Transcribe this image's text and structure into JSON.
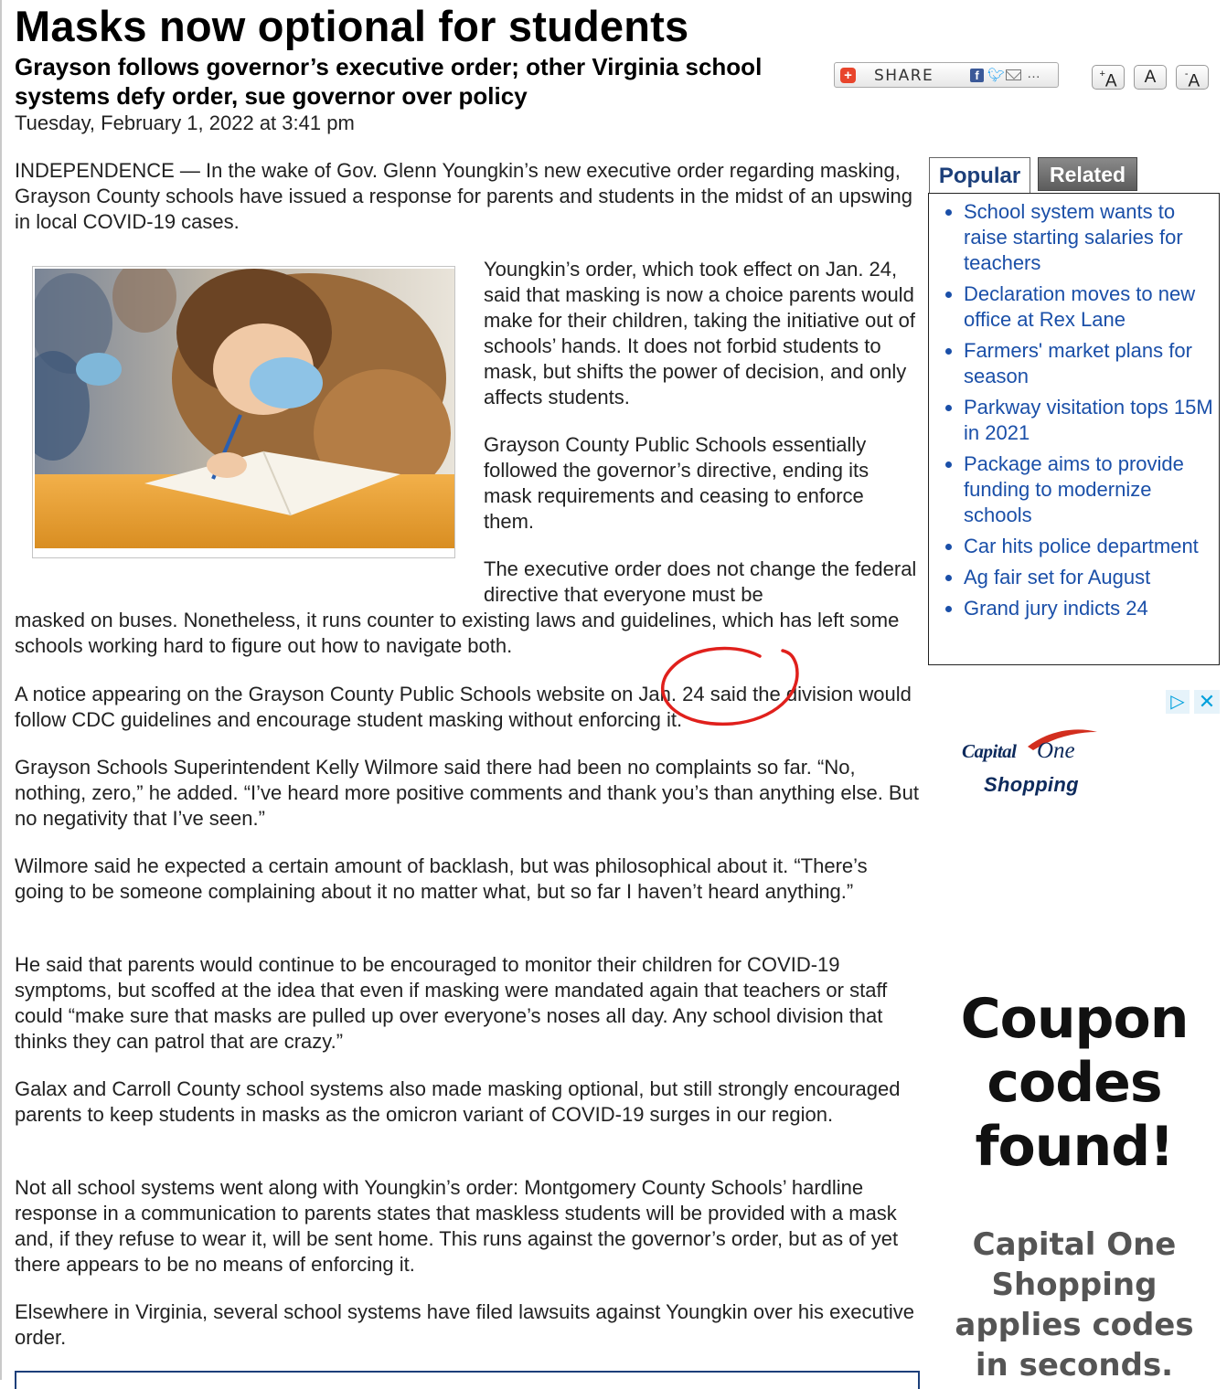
{
  "article": {
    "headline": "Masks now optional for students",
    "subhead": "Grayson follows governor’s executive order; other Virginia school systems defy order, sue governor over policy",
    "dateline": "Tuesday, February 1, 2022 at 3:41 pm",
    "paragraphs": [
      "INDEPENDENCE — In the wake of Gov. Glenn Youngkin’s new executive order regarding masking, Grayson County schools have issued a response for parents and students in the midst of an upswing in local COVID-19 cases.",
      "Youngkin’s order, which took effect on Jan. 24, said that masking is now a choice parents would make for their children, taking the initiative out of schools’ hands. It does not forbid students to mask, but shifts the power of decision, and only affects students.",
      "Grayson County Public Schools essentially followed the governor’s directive, ending its mask requirements and ceasing to enforce them.",
      "The executive order does not change the federal directive that everyone must be",
      "masked on buses. Nonetheless, it runs counter to existing laws and guidelines, which has left some schools working hard to figure out how to navigate both.",
      "A notice appearing on the Grayson County Public Schools website on Jan. 24 said the division would follow CDC guidelines and encourage student masking without enforcing it.",
      "Grayson Schools Superintendent Kelly Wilmore said there had been no complaints so far. “No, nothing, zero,” he added. “I’ve heard more positive comments and thank you’s than anything else. But no negativity that I’ve seen.”",
      "Wilmore said he expected a certain amount of backlash, but was philosophical about it. “There’s going to be someone complaining about it no matter what, but so far I haven’t heard anything.”",
      "He said that parents would continue to be encouraged to monitor their children for COVID-19 symptoms, but scoffed at the idea that even if masking were mandated again that teachers or staff could “make sure that masks are pulled up over everyone’s noses all day. Any school division that thinks they can patrol that are crazy.”",
      "Galax and Carroll County school systems also made masking optional, but still strongly encouraged parents to keep students in masks as the omicron variant of COVID-19 surges in our region.",
      "Not all school systems went along with Youngkin’s order: Montgomery County Schools’ hardline response in a communication to parents states that maskless students will be provided with a mask and, if they refuse to wear it, will be sent home. This runs against the governor’s order, but as of yet there appears to be no means of enforcing it.",
      "Elsewhere in Virginia, several school systems have filed lawsuits against Youngkin over his executive order."
    ]
  },
  "share": {
    "label": "SHARE",
    "plus_glyph": "+",
    "icons": [
      "facebook-icon",
      "twitter-icon",
      "email-icon",
      "more-icon"
    ]
  },
  "font_controls": {
    "increase": "A",
    "reset": "A",
    "decrease": "A",
    "increase_mark": "+",
    "decrease_mark": "-"
  },
  "sidebar": {
    "tabs": [
      {
        "label": "Popular",
        "active": true
      },
      {
        "label": "Related",
        "active": false
      }
    ],
    "popular_items": [
      "School system wants to raise starting salaries for teachers",
      "Declaration moves to new office at Rex Lane",
      "Farmers' market plans for season",
      "Parkway visitation tops 15M in 2021",
      "Package aims to provide funding to modernize schools",
      "Car hits police department",
      "Ag fair set for August",
      "Grand jury indicts 24"
    ]
  },
  "ad": {
    "logo_capital": "Capital",
    "logo_one": "One",
    "logo_sub": "Shopping",
    "headline": "Coupon\ncodes\nfound!",
    "body": "Capital One\nShopping\napplies codes\nin seconds."
  },
  "colors": {
    "link": "#1a4fa8",
    "tab_text": "#1c3f7a",
    "annotation_red": "#e0201c",
    "brand_navy": "#0d2a5c",
    "brand_red": "#d22e1e"
  }
}
